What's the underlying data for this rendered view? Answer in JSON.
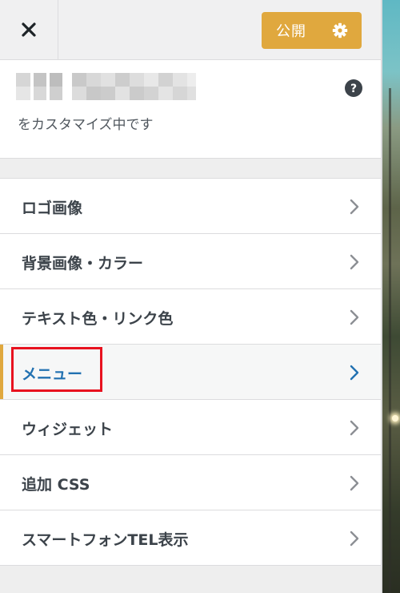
{
  "header": {
    "publish_label": "公開"
  },
  "info": {
    "customizing_text": "をカスタマイズ中です"
  },
  "menu": {
    "items": [
      {
        "label": "ロゴ画像"
      },
      {
        "label": "背景画像・カラー"
      },
      {
        "label": "テキスト色・リンク色"
      },
      {
        "label": "メニュー",
        "active": true
      },
      {
        "label": "ウィジェット"
      },
      {
        "label": "追加 CSS"
      },
      {
        "label": "スマートフォンTEL表示"
      }
    ]
  },
  "colors": {
    "publish_button": "#e0a83e",
    "active_label": "#2271b1",
    "highlight_border": "#e8121f"
  },
  "icons": [
    "close-icon",
    "gear-icon",
    "help-icon",
    "chevron-right-icon"
  ]
}
